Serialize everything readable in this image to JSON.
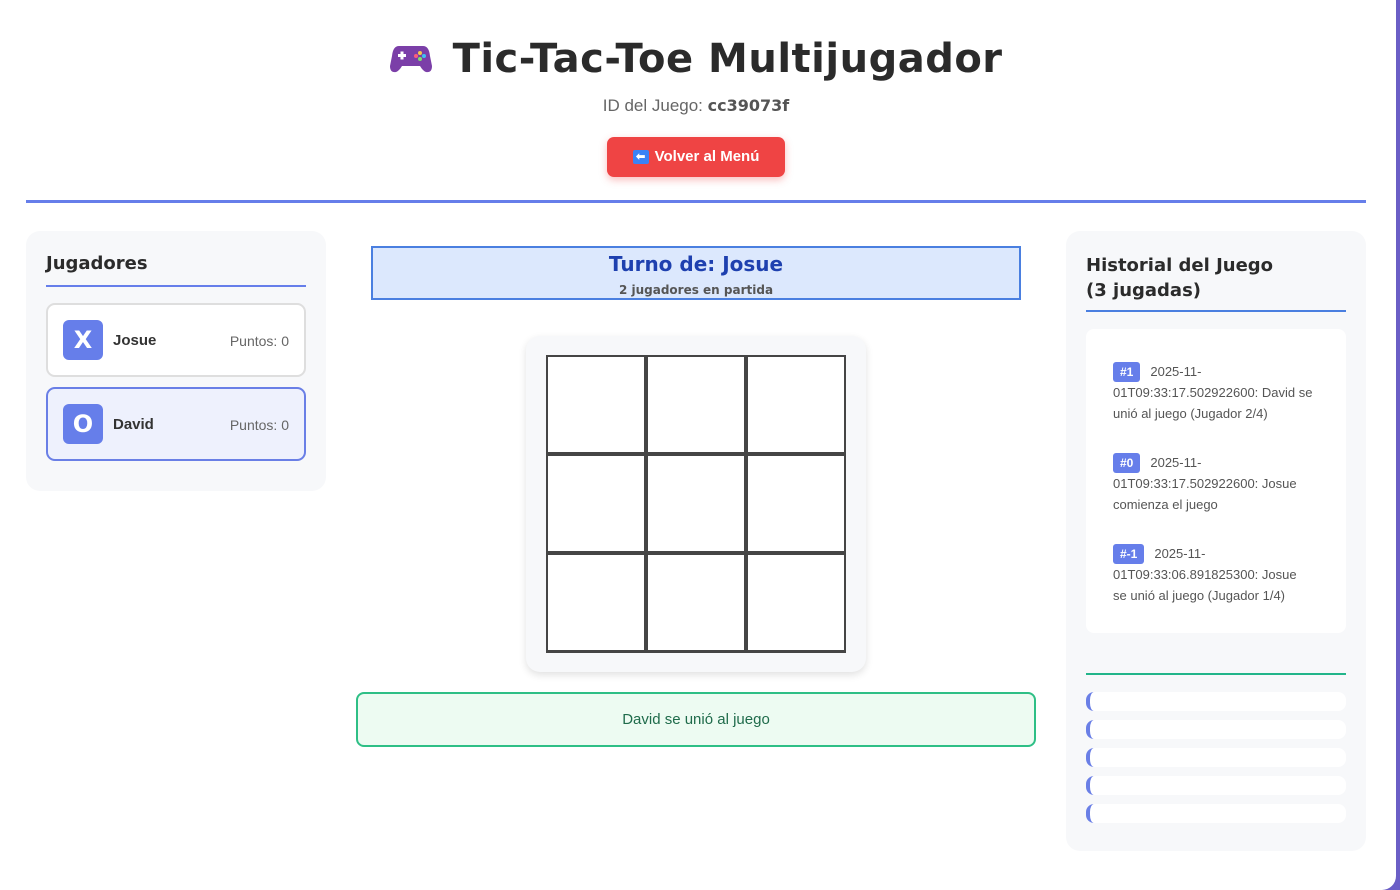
{
  "header": {
    "title": "Tic-Tac-Toe Multijugador",
    "title_icon": "gamepad-icon",
    "game_id_label": "ID del Juego:",
    "game_id": "cc39073f",
    "back_button": "Volver al Menú",
    "back_icon": "arrow-left-icon"
  },
  "players": {
    "title": "Jugadores",
    "list": [
      {
        "symbol": "X",
        "name": "Josue",
        "score": "Puntos: 0",
        "active": false
      },
      {
        "symbol": "O",
        "name": "David",
        "score": "Puntos: 0",
        "active": true
      }
    ]
  },
  "turn": {
    "title": "Turno de: Josue",
    "subtitle": "2 jugadores en partida"
  },
  "board": {
    "cells": [
      "",
      "",
      "",
      "",
      "",
      "",
      "",
      "",
      ""
    ]
  },
  "notice": "David se unió al juego",
  "history": {
    "title": "Historial del Juego (3 jugadas)",
    "entries": [
      {
        "badge": "#1",
        "text": "2025-11-01T09:33:17.502922600: David se unió al juego (Jugador 2/4)"
      },
      {
        "badge": "#0",
        "text": "2025-11-01T09:33:17.502922600: Josue comienza el juego"
      },
      {
        "badge": "#-1",
        "text": "2025-11-01T09:33:06.891825300: Josue se unió al juego (Jugador 1/4)"
      }
    ]
  },
  "colors": {
    "accent": "#667eea",
    "danger": "#ef4444",
    "turn_text": "#1e40af",
    "success": "#2ebf86"
  }
}
